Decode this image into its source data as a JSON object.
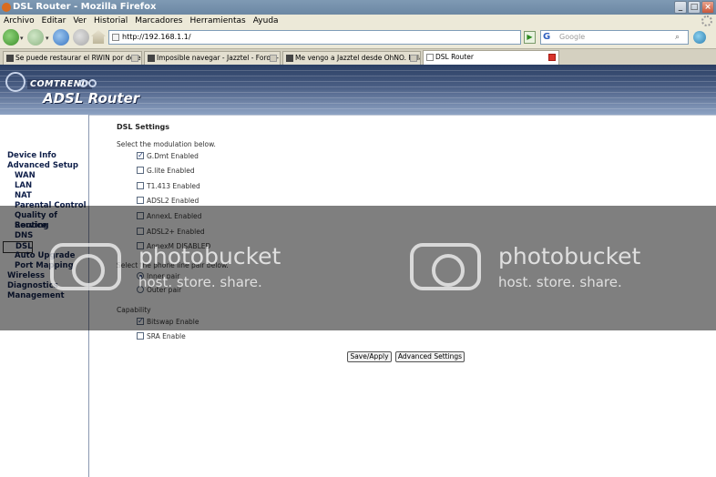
{
  "window": {
    "title": "DSL Router - Mozilla Firefox",
    "min_glyph": "_",
    "max_glyph": "□",
    "close_glyph": "×"
  },
  "menu": [
    "Archivo",
    "Editar",
    "Ver",
    "Historial",
    "Marcadores",
    "Herramientas",
    "Ayuda"
  ],
  "nav": {
    "url": "http://192.168.1.1/",
    "go_glyph": "▶",
    "search_engine_glyph": "G",
    "search_placeholder": "Google",
    "search_glyph": "⌕",
    "dropdown_glyph": "▾"
  },
  "tabs": [
    {
      "label": "Se puede restaurar el RWIN por defec...",
      "active": false
    },
    {
      "label": "Imposible navegar - Jazztel - Foros - B...",
      "active": false
    },
    {
      "label": "Me vengo a Jazztel desde OhNO. Rela...",
      "active": false
    },
    {
      "label": "DSL Router",
      "active": true
    }
  ],
  "router": {
    "brand": "COMTREND",
    "product": "ADSL Router"
  },
  "sidebar": [
    {
      "label": "Device Info",
      "sub": false,
      "selected": false
    },
    {
      "label": "Advanced Setup",
      "sub": false,
      "selected": false
    },
    {
      "label": "WAN",
      "sub": true,
      "selected": false
    },
    {
      "label": "LAN",
      "sub": true,
      "selected": false
    },
    {
      "label": "NAT",
      "sub": true,
      "selected": false
    },
    {
      "label": "Parental Control",
      "sub": true,
      "selected": false
    },
    {
      "label": "Quality of Service",
      "sub": true,
      "selected": false
    },
    {
      "label": "Routing",
      "sub": true,
      "selected": false
    },
    {
      "label": "DNS",
      "sub": true,
      "selected": false
    },
    {
      "label": "DSL",
      "sub": true,
      "selected": true
    },
    {
      "label": "Auto Upgrade",
      "sub": true,
      "selected": false
    },
    {
      "label": "Port Mapping",
      "sub": true,
      "selected": false
    },
    {
      "label": "Wireless",
      "sub": false,
      "selected": false
    },
    {
      "label": "Diagnostics",
      "sub": false,
      "selected": false
    },
    {
      "label": "Management",
      "sub": false,
      "selected": false
    }
  ],
  "dsl": {
    "title": "DSL Settings",
    "modulation_label": "Select the modulation below.",
    "modulations": [
      {
        "label": "G.Dmt Enabled",
        "checked": true
      },
      {
        "label": "G.lite Enabled",
        "checked": false
      },
      {
        "label": "T1.413 Enabled",
        "checked": false
      },
      {
        "label": "ADSL2 Enabled",
        "checked": false
      },
      {
        "label": "AnnexL Enabled",
        "checked": false
      },
      {
        "label": "ADSL2+ Enabled",
        "checked": false
      },
      {
        "label": "AnnexM DISABLED",
        "checked": false
      }
    ],
    "pair_label": "Select the phone line pair below.",
    "pairs": [
      {
        "label": "Inner pair",
        "checked": true
      },
      {
        "label": "Outer pair",
        "checked": false
      }
    ],
    "capability_label": "Capability",
    "capabilities": [
      {
        "label": "Bitswap Enable",
        "checked": true
      },
      {
        "label": "SRA Enable",
        "checked": false
      }
    ],
    "save_label": "Save/Apply",
    "advanced_label": "Advanced Settings"
  },
  "watermark": {
    "name": "photobucket",
    "tagline": "host. store. share."
  }
}
